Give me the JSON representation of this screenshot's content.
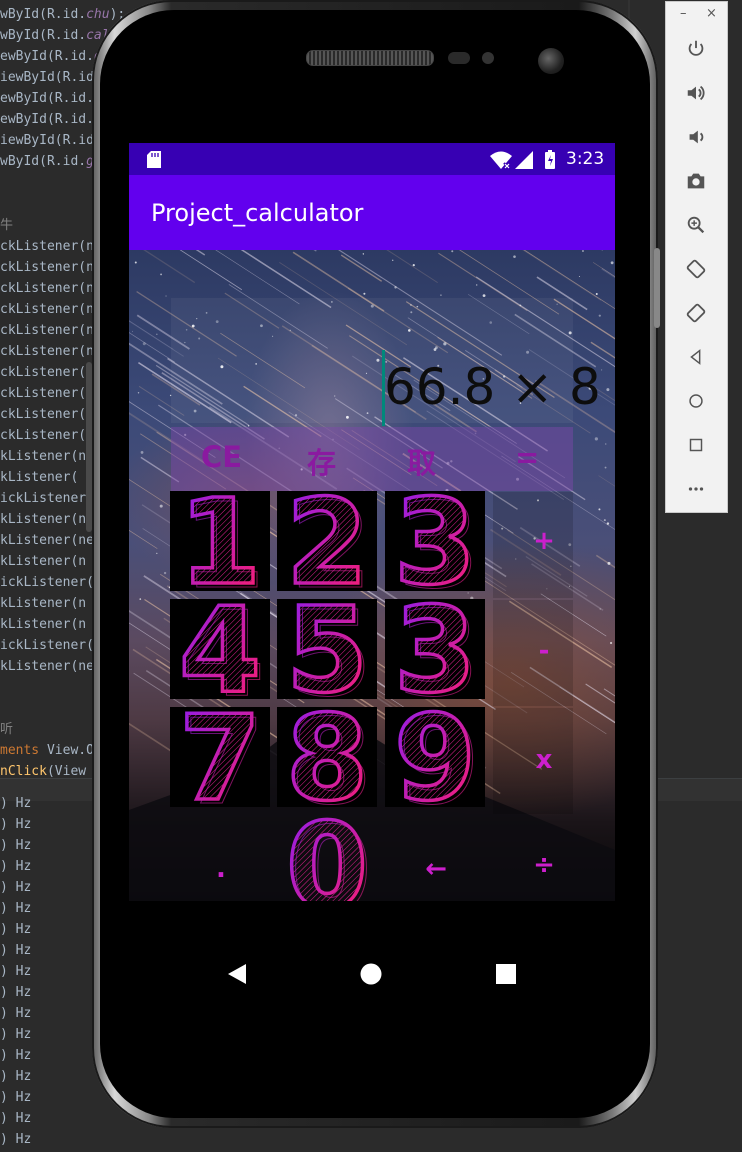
{
  "ide": {
    "code_lines": [
      {
        "pre": "wById(R.id.",
        "field": "chu",
        "post": ");"
      },
      {
        "pre": "wById(R.id.",
        "field": "calc",
        "post": ""
      },
      {
        "pre": "ewById(R.id.",
        "field": "d",
        "post": ""
      },
      {
        "pre": "iewById(R.id",
        "field": "",
        "post": ""
      },
      {
        "pre": "ewById(R.id.",
        "field": "",
        "post": ""
      },
      {
        "pre": "ewById(R.id.",
        "field": "",
        "post": ""
      },
      {
        "pre": "iewById(R.id",
        "field": "",
        "post": ""
      },
      {
        "pre": "wById(R.id.",
        "field": "g",
        "post": ""
      }
    ],
    "comment_char": "牛",
    "listener_lines": [
      "ckListener(n",
      "ckListener(n",
      "ckListener(n",
      "ckListener(n",
      "ckListener(n",
      "ckListener(n",
      "ckListener(",
      "ckListener(",
      "ckListener(",
      "ckListener(",
      "kListener(n",
      "kListener(",
      "ickListener(",
      "kListener(n",
      "kListener(ne",
      "kListener(n",
      "ickListener(",
      "kListener(n",
      "kListener(n",
      "ickListener(",
      "kListener(ne"
    ],
    "comment2": "听",
    "impl_line": {
      "kw": "ments",
      "post": " View.O"
    },
    "onclick_line": {
      "fn": "nClick",
      "post": "(View"
    },
    "console_unit": "Hz",
    "console_prefix": ")"
  },
  "emulator_toolbar": {
    "minimize": "–",
    "close": "×",
    "buttons": [
      "power-icon",
      "volume-up-icon",
      "volume-down-icon",
      "camera-icon",
      "zoom-icon",
      "rotate-left-icon",
      "rotate-right-icon",
      "back-icon",
      "home-icon",
      "overview-icon",
      "more-icon"
    ]
  },
  "status_bar": {
    "time": "3:23"
  },
  "app_bar": {
    "title": "Project_calculator"
  },
  "display": {
    "expression": "66.8 × 8"
  },
  "memory_row": {
    "clear": "CE",
    "store": "存",
    "recall": "取",
    "equals": "="
  },
  "digits": {
    "row1": [
      "1",
      "2",
      "3"
    ],
    "row2": [
      "4",
      "5",
      "3"
    ],
    "row3": [
      "7",
      "8",
      "9"
    ],
    "zero": "0"
  },
  "operators": {
    "plus": "+",
    "minus": "-",
    "times": "x",
    "divide": "÷",
    "dot": ".",
    "backspace": "←"
  },
  "colors": {
    "status_bar": "#3700b3",
    "app_bar": "#6200ee",
    "accent": "#cc1fcc",
    "cursor": "#00897b"
  }
}
